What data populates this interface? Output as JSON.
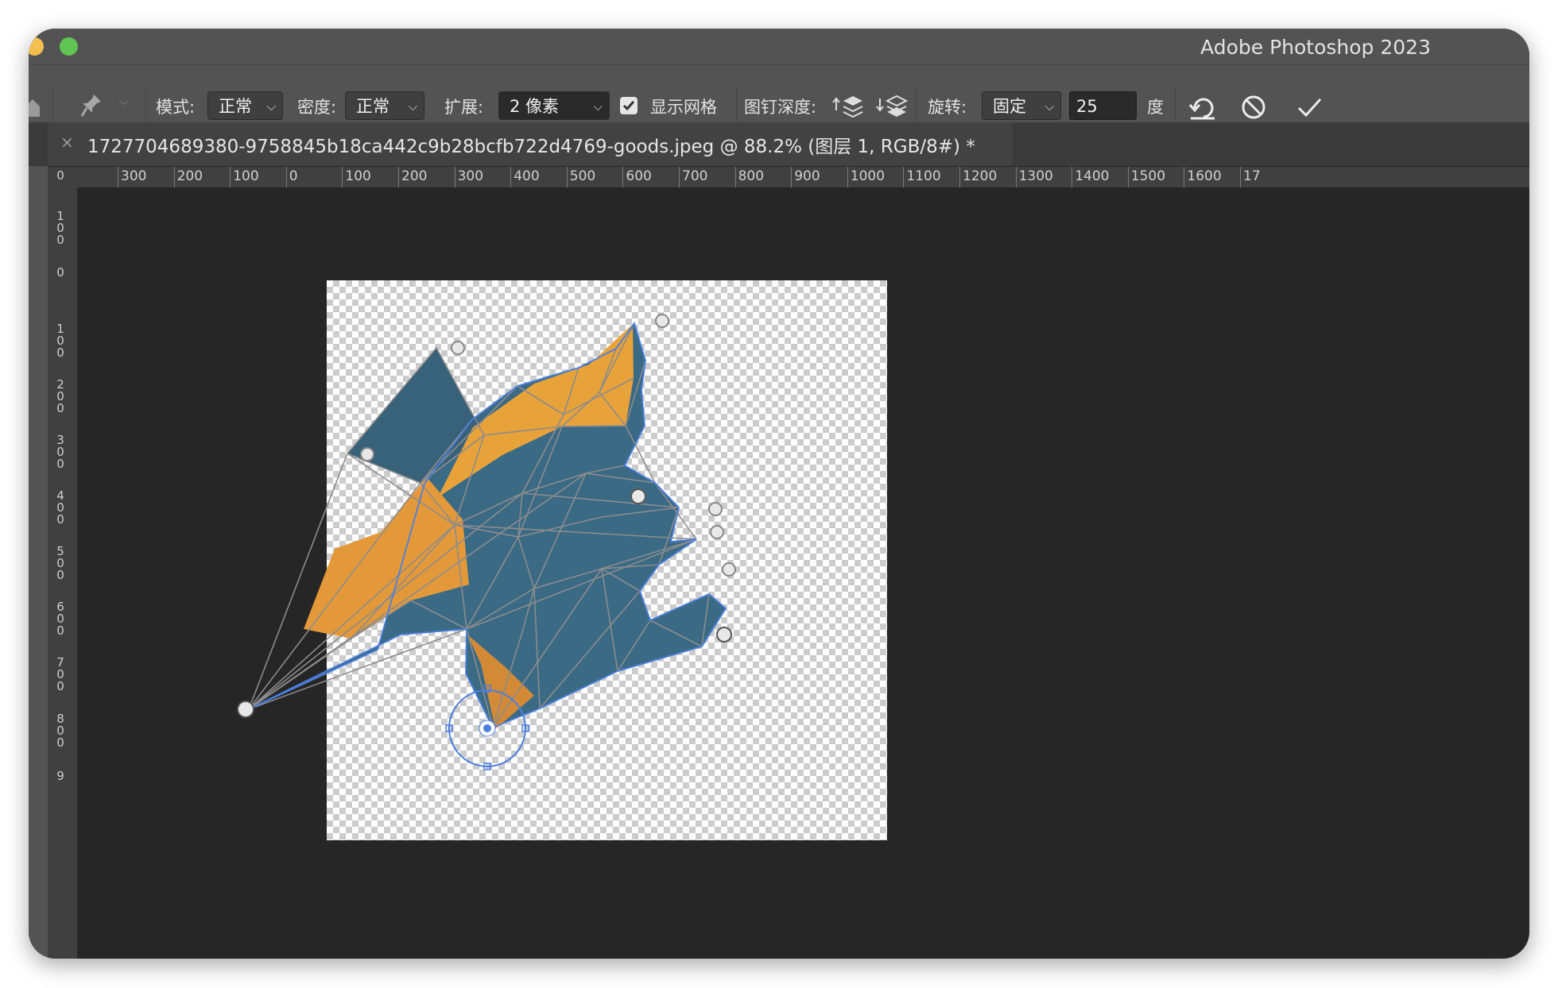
{
  "window": {
    "app_title": "Adobe Photoshop 2023"
  },
  "options": {
    "mode_label": "模式:",
    "mode_value": "正常",
    "density_label": "密度:",
    "density_value": "正常",
    "expand_label": "扩展:",
    "expand_value": "2 像素",
    "show_mesh_label": "显示网格",
    "show_mesh_checked": true,
    "pin_depth_label": "图钉深度:",
    "rotate_label": "旋转:",
    "rotate_mode": "固定",
    "rotate_value": "25",
    "rotate_unit": "度",
    "icons": [
      "home-icon",
      "pin-icon",
      "pin-front-icon",
      "pin-back-icon",
      "undo-icon",
      "cancel-icon",
      "commit-icon"
    ]
  },
  "document": {
    "tab_title": "1727704689380-9758845b18ca442c9b28bcfb722d4769-goods.jpeg @ 88.2% (图层 1, RGB/8#) *",
    "zoom": "88.2%"
  },
  "rulers": {
    "horizontal": [
      "300",
      "200",
      "100",
      "0",
      "100",
      "200",
      "300",
      "400",
      "500",
      "600",
      "700",
      "800",
      "900",
      "1000",
      "1100",
      "1200",
      "1300",
      "1400",
      "1500",
      "1600",
      "17"
    ],
    "vertical": [
      "0",
      "100",
      "0",
      "100",
      "200",
      "300",
      "400",
      "500",
      "600",
      "700",
      "800",
      "9"
    ]
  },
  "colors": {
    "window_bg": "#262626",
    "chrome": "#535353",
    "mesh_line": "#8c8c8c",
    "selection": "#4a7fe0",
    "object_blue": "#3b6a85",
    "object_orange": "#e8a23a"
  }
}
